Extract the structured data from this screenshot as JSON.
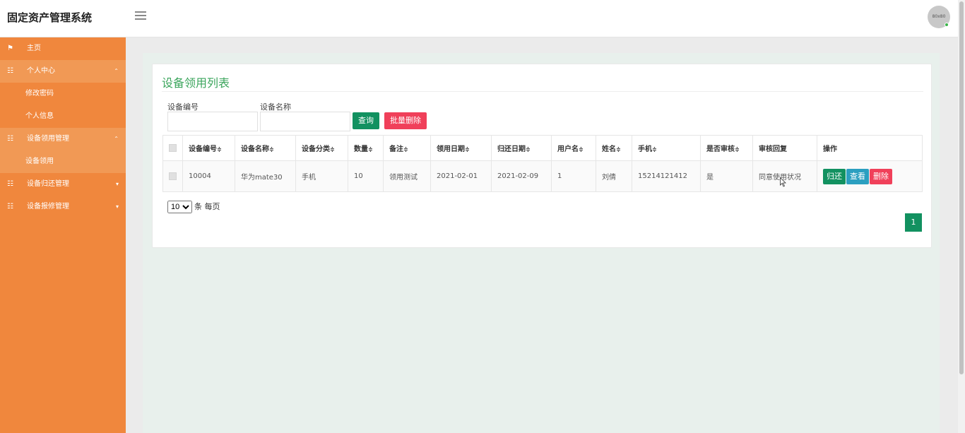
{
  "app": {
    "title": "固定资产管理系统",
    "avatar_text": "80x80"
  },
  "sidebar": {
    "items": [
      {
        "label": "主页",
        "icon": "flag-icon",
        "glyph": "⚑"
      },
      {
        "label": "个人中心",
        "icon": "grid-icon",
        "glyph": "☷",
        "caret": "⌃"
      },
      {
        "label": "修改密码"
      },
      {
        "label": "个人信息"
      },
      {
        "label": "设备领用管理",
        "icon": "grid-icon",
        "glyph": "☷",
        "caret": "⌃"
      },
      {
        "label": "设备领用"
      },
      {
        "label": "设备归还管理",
        "icon": "grid-icon",
        "glyph": "☷",
        "caret": "▾"
      },
      {
        "label": "设备报修管理",
        "icon": "grid-icon",
        "glyph": "☷",
        "caret": "▾"
      }
    ]
  },
  "panel": {
    "title": "设备领用列表",
    "search": {
      "code_label": "设备编号",
      "code_value": "",
      "name_label": "设备名称",
      "name_value": "",
      "query_button": "查询",
      "batch_delete_button": "批量删除"
    },
    "table": {
      "sort_glyph": "≑",
      "headers": [
        "设备编号",
        "设备名称",
        "设备分类",
        "数量",
        "备注",
        "领用日期",
        "归还日期",
        "用户名",
        "姓名",
        "手机",
        "是否审核",
        "审核回复",
        "操作"
      ],
      "rows": [
        {
          "cells": [
            "10004",
            "华为mate30",
            "手机",
            "10",
            "领用测试",
            "2021-02-01",
            "2021-02-09",
            "1",
            "刘倩",
            "15214121412",
            "是",
            "同意使用状况"
          ],
          "actions": {
            "return": "归还",
            "view": "查看",
            "delete": "删除"
          }
        }
      ]
    },
    "page_size": {
      "value": "10",
      "options": [
        "10"
      ],
      "suffix": "条 每页"
    },
    "pager": {
      "current": "1"
    }
  },
  "colors": {
    "sidebar": "#f0873d",
    "primary": "#129160",
    "danger": "#f0405a",
    "info": "#2b9fc0",
    "title": "#3ba55c"
  }
}
